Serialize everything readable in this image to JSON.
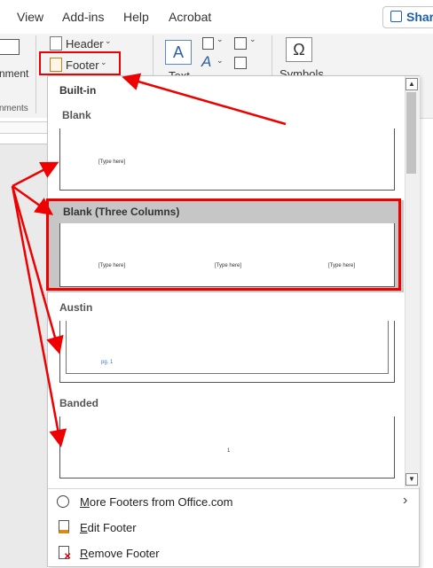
{
  "tabs": [
    "View",
    "Add-ins",
    "Help",
    "Acrobat"
  ],
  "share_label": "Share",
  "ribbon": {
    "comment_label": "nment",
    "comments_group": "nments",
    "header_label": "Header",
    "footer_label": "Footer",
    "text_label": "Text",
    "symbols_label": "Symbols",
    "omega_glyph": "Ω",
    "a_glyph": "A"
  },
  "gallery": {
    "section": "Built-in",
    "items": [
      {
        "name": "Blank",
        "placeholders": [
          "[Type here]"
        ]
      },
      {
        "name": "Blank (Three Columns)",
        "placeholders": [
          "[Type here]",
          "[Type here]",
          "[Type here]"
        ]
      },
      {
        "name": "Austin",
        "placeholders": [
          "pg. 1"
        ]
      },
      {
        "name": "Banded",
        "placeholders": [
          "1"
        ]
      }
    ]
  },
  "menu": {
    "more": "More Footers from Office.com",
    "edit": "Edit Footer",
    "remove": "Remove Footer"
  },
  "colors": {
    "annotation": "#e00000",
    "selection": "#c6c6c6",
    "share_text": "#1f5fa8"
  }
}
